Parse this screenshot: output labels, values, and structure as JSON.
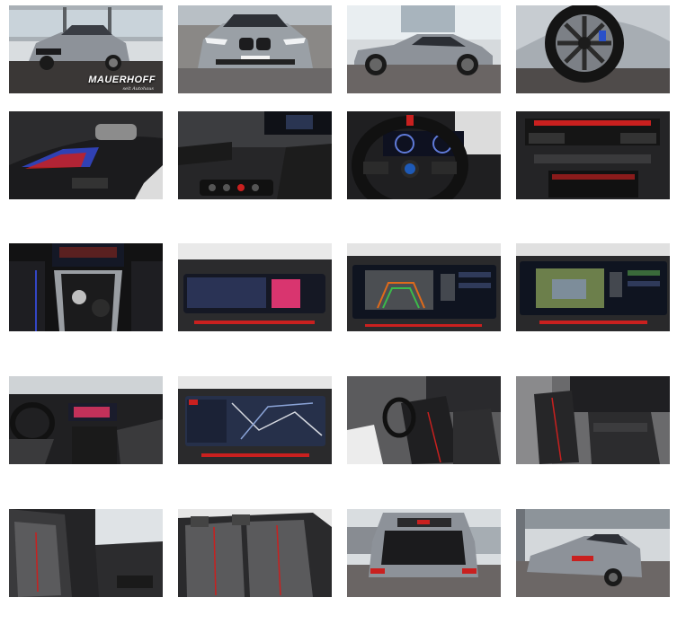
{
  "gallery": {
    "thumbnails": [
      {
        "subject": "car-front-three-quarter-showroom",
        "logo": {
          "name": "MAUERHOFF",
          "sub": "seit Autohaus"
        }
      },
      {
        "subject": "car-front-view"
      },
      {
        "subject": "car-side-profile"
      },
      {
        "subject": "wheel-closeup"
      },
      {
        "subject": "door-panel-ambient-light"
      },
      {
        "subject": "door-seat-controls"
      },
      {
        "subject": "steering-wheel-cockpit"
      },
      {
        "subject": "dashboard-center-vents"
      },
      {
        "subject": "center-console-gear-selector"
      },
      {
        "subject": "infotainment-media-screen"
      },
      {
        "subject": "infotainment-rear-camera"
      },
      {
        "subject": "infotainment-parking-view"
      },
      {
        "subject": "interior-dashboard-wide"
      },
      {
        "subject": "infotainment-navigation-map"
      },
      {
        "subject": "front-seats-driver-door-open"
      },
      {
        "subject": "front-seats-passenger-side"
      },
      {
        "subject": "front-passenger-seat-closeup"
      },
      {
        "subject": "rear-seats"
      },
      {
        "subject": "open-trunk"
      },
      {
        "subject": "car-rear-three-quarter"
      }
    ]
  },
  "colors": {
    "car_grey": "#8d9299",
    "asphalt": "#5a5858",
    "interior_black": "#1c1c1e",
    "screen_dark": "#13161f",
    "accent_red": "#c9201f",
    "ambient_blue": "#3346c4"
  }
}
